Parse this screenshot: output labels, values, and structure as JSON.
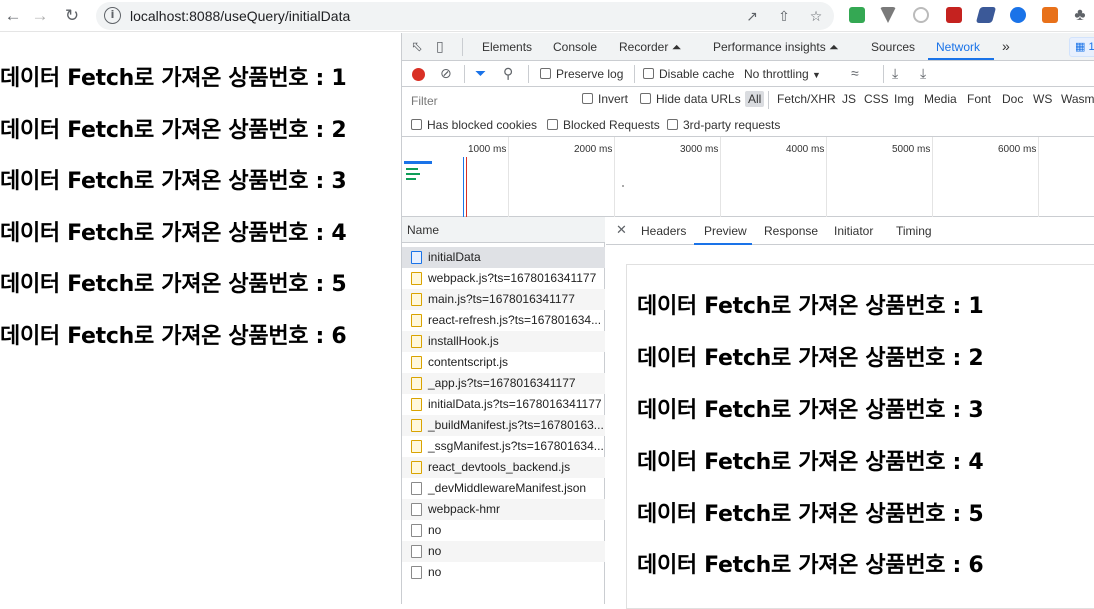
{
  "browser": {
    "url": "localhost:8088/useQuery/initialData"
  },
  "page": {
    "headings": [
      "데이터 Fetch로 가져온 상품번호 : 1",
      "데이터 Fetch로 가져온 상품번호 : 2",
      "데이터 Fetch로 가져온 상품번호 : 3",
      "데이터 Fetch로 가져온 상품번호 : 4",
      "데이터 Fetch로 가져온 상품번호 : 5",
      "데이터 Fetch로 가져온 상품번호 : 6"
    ]
  },
  "devtools": {
    "tabs": [
      "Elements",
      "Console",
      "Recorder ⏶",
      "Performance insights ⏶",
      "Sources",
      "Network"
    ],
    "active_tab": "Network",
    "more": "»",
    "badge": "1",
    "toolbar": {
      "preserve_log": "Preserve log",
      "disable_cache": "Disable cache",
      "throttling": "No throttling"
    },
    "filter": {
      "placeholder": "Filter",
      "invert": "Invert",
      "hide_data_urls": "Hide data URLs",
      "types": [
        "All",
        "Fetch/XHR",
        "JS",
        "CSS",
        "Img",
        "Media",
        "Font",
        "Doc",
        "WS",
        "Wasm"
      ]
    },
    "options": {
      "blocked_cookies": "Has blocked cookies",
      "blocked_requests": "Blocked Requests",
      "third_party": "3rd-party requests"
    },
    "timeline_labels": [
      "1000 ms",
      "2000 ms",
      "3000 ms",
      "4000 ms",
      "5000 ms",
      "6000 ms"
    ],
    "list_header": "Name",
    "requests": [
      {
        "name": "initialData",
        "kind": "doc"
      },
      {
        "name": "webpack.js?ts=1678016341177",
        "kind": "js"
      },
      {
        "name": "main.js?ts=1678016341177",
        "kind": "js"
      },
      {
        "name": "react-refresh.js?ts=167801634...",
        "kind": "js"
      },
      {
        "name": "installHook.js",
        "kind": "js"
      },
      {
        "name": "contentscript.js",
        "kind": "js"
      },
      {
        "name": "_app.js?ts=1678016341177",
        "kind": "js"
      },
      {
        "name": "initialData.js?ts=1678016341177",
        "kind": "js"
      },
      {
        "name": "_buildManifest.js?ts=16780163...",
        "kind": "js"
      },
      {
        "name": "_ssgManifest.js?ts=167801634...",
        "kind": "js"
      },
      {
        "name": "react_devtools_backend.js",
        "kind": "js"
      },
      {
        "name": "_devMiddlewareManifest.json",
        "kind": "other"
      },
      {
        "name": "webpack-hmr",
        "kind": "other"
      },
      {
        "name": "no",
        "kind": "other"
      },
      {
        "name": "no",
        "kind": "other"
      },
      {
        "name": "no",
        "kind": "other"
      }
    ],
    "detail_tabs": [
      "Headers",
      "Preview",
      "Response",
      "Initiator",
      "Timing"
    ],
    "active_detail_tab": "Preview",
    "preview_headings": [
      "데이터 Fetch로 가져온 상품번호 : 1",
      "데이터 Fetch로 가져온 상품번호 : 2",
      "데이터 Fetch로 가져온 상품번호 : 3",
      "데이터 Fetch로 가져온 상품번호 : 4",
      "데이터 Fetch로 가져온 상품번호 : 5",
      "데이터 Fetch로 가져온 상품번호 : 6"
    ]
  }
}
